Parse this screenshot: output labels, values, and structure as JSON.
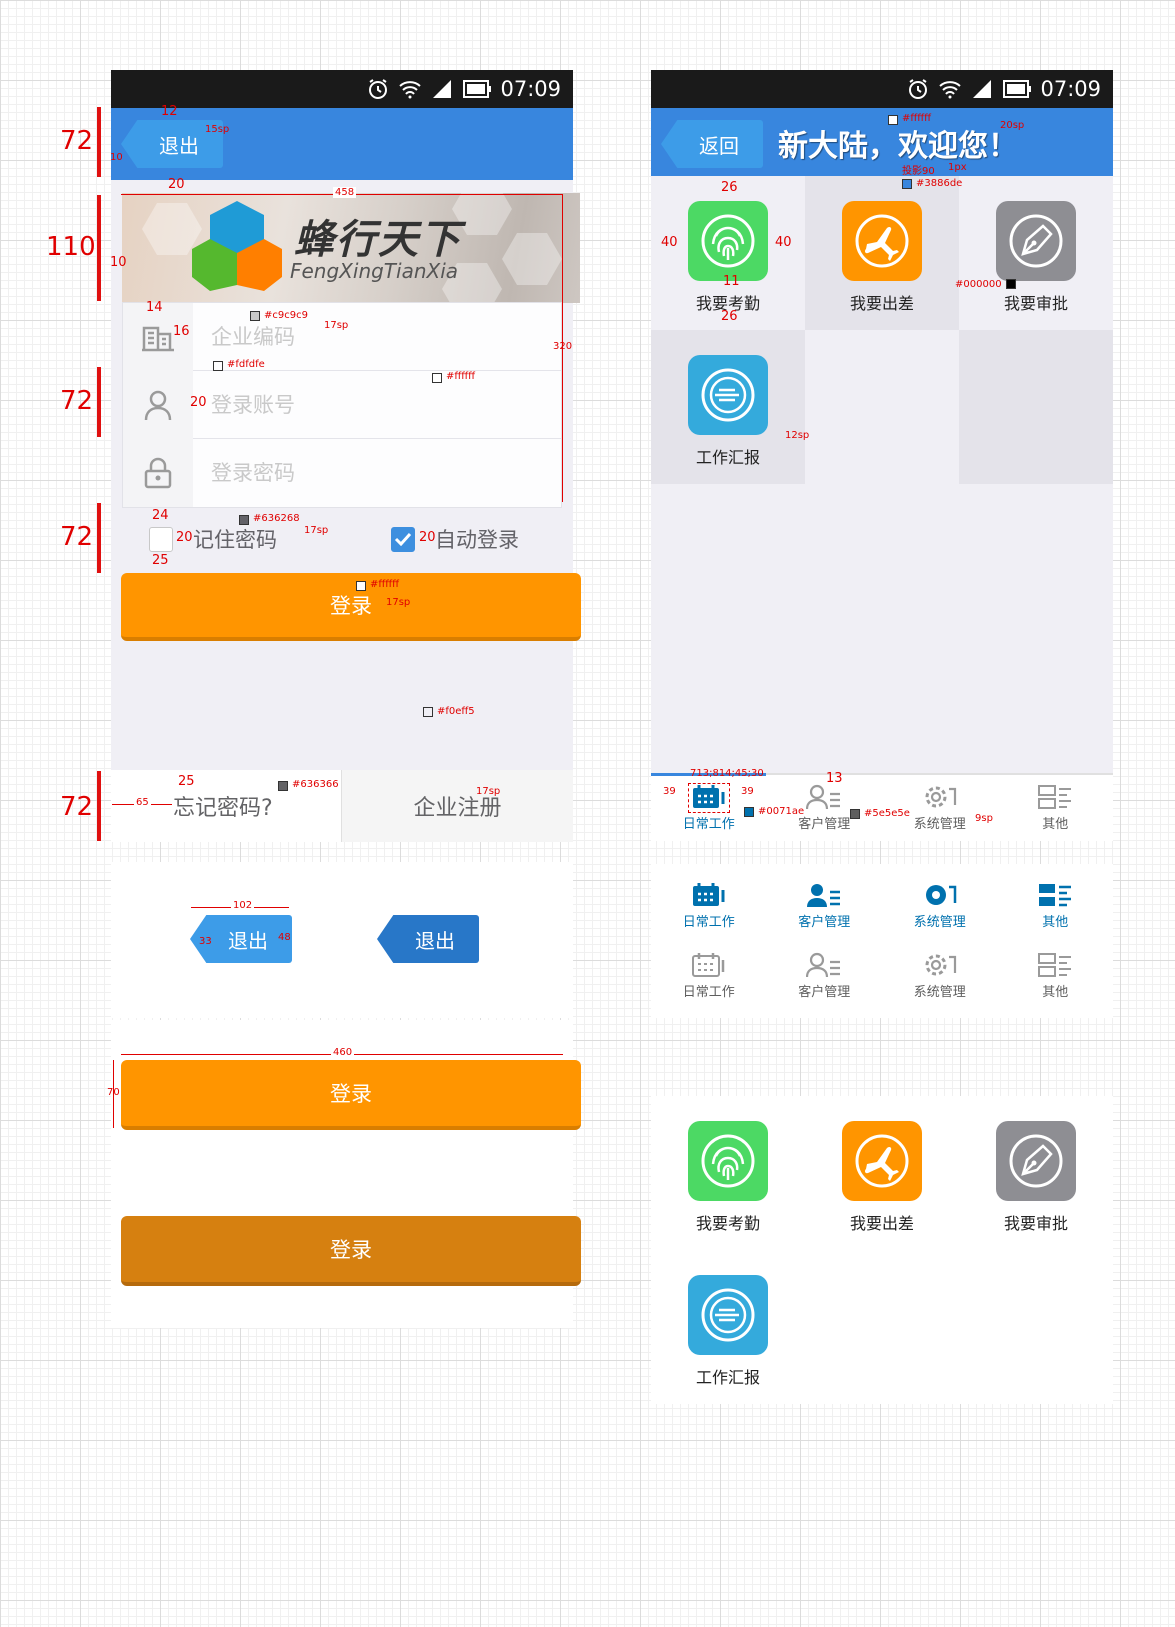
{
  "status_bar": {
    "time": "07:09"
  },
  "login": {
    "back_label": "退出",
    "logo_title": "蜂行天下",
    "logo_subtitle": "FengXingTianXia",
    "company_placeholder": "企业编码",
    "account_placeholder": "登录账号",
    "password_placeholder": "登录密码",
    "remember_label": "记住密码",
    "auto_login_label": "自动登录",
    "login_label": "登录",
    "forgot_label": "忘记密码?",
    "register_label": "企业注册"
  },
  "home": {
    "back_label": "返回",
    "welcome": "新大陆，欢迎您！",
    "apps": [
      {
        "label": "我要考勤",
        "icon": "fingerprint-icon",
        "color": "#4cd964"
      },
      {
        "label": "我要出差",
        "icon": "airplane-icon",
        "color": "#ff9500"
      },
      {
        "label": "我要审批",
        "icon": "pen-nib-icon",
        "color": "#8e8e93"
      },
      {
        "label": "工作汇报",
        "icon": "report-icon",
        "color": "#34aadc"
      }
    ],
    "tabs": [
      {
        "label": "日常工作",
        "icon": "calendar-icon"
      },
      {
        "label": "客户管理",
        "icon": "customer-icon"
      },
      {
        "label": "系统管理",
        "icon": "gear-icon"
      },
      {
        "label": "其他",
        "icon": "list-icon"
      }
    ]
  },
  "specs": {
    "back_active_label": "退出",
    "login_normal": "登录",
    "login_pressed": "登录",
    "tabs_active": [
      "日常工作",
      "客户管理",
      "系统管理",
      "其他"
    ],
    "tabs_normal": [
      "日常工作",
      "客户管理",
      "系统管理",
      "其他"
    ],
    "apps": [
      "我要考勤",
      "我要出差",
      "我要审批",
      "工作汇报"
    ]
  },
  "annotations": {
    "h72": "72",
    "h110": "110",
    "dim_12": "12",
    "dim_15sp": "15sp",
    "dim_10": "10",
    "dim_20": "20",
    "dim_458": "458",
    "dim_320": "320",
    "dim_14": "14",
    "dim_16": "16",
    "dim_17sp": "17sp",
    "dim_24": "24",
    "dim_25": "25",
    "dim_65": "65",
    "dim_102": "102",
    "dim_33": "33",
    "dim_48": "48",
    "dim_460": "460",
    "dim_70": "70",
    "dim_26": "26",
    "dim_40": "40",
    "dim_11": "11",
    "dim_12sp": "12sp",
    "dim_13": "13",
    "dim_39": "39",
    "dim_9sp": "9sp",
    "dim_20sp": "20sp",
    "tab_coords": "713;814;45;30",
    "shadow_note": "投影90",
    "shadow_px": "1px",
    "c_c9c9c9": "#c9c9c9",
    "c_fdfdfe": "#fdfdfe",
    "c_ffffff": "#ffffff",
    "c_636268": "#636268",
    "c_f0eff5": "#f0eff5",
    "c_636366": "#636366",
    "c_3886de": "#3886de",
    "c_000000": "#000000",
    "c_0071ae": "#0071ae",
    "c_5e5e5e": "#5e5e5e"
  }
}
